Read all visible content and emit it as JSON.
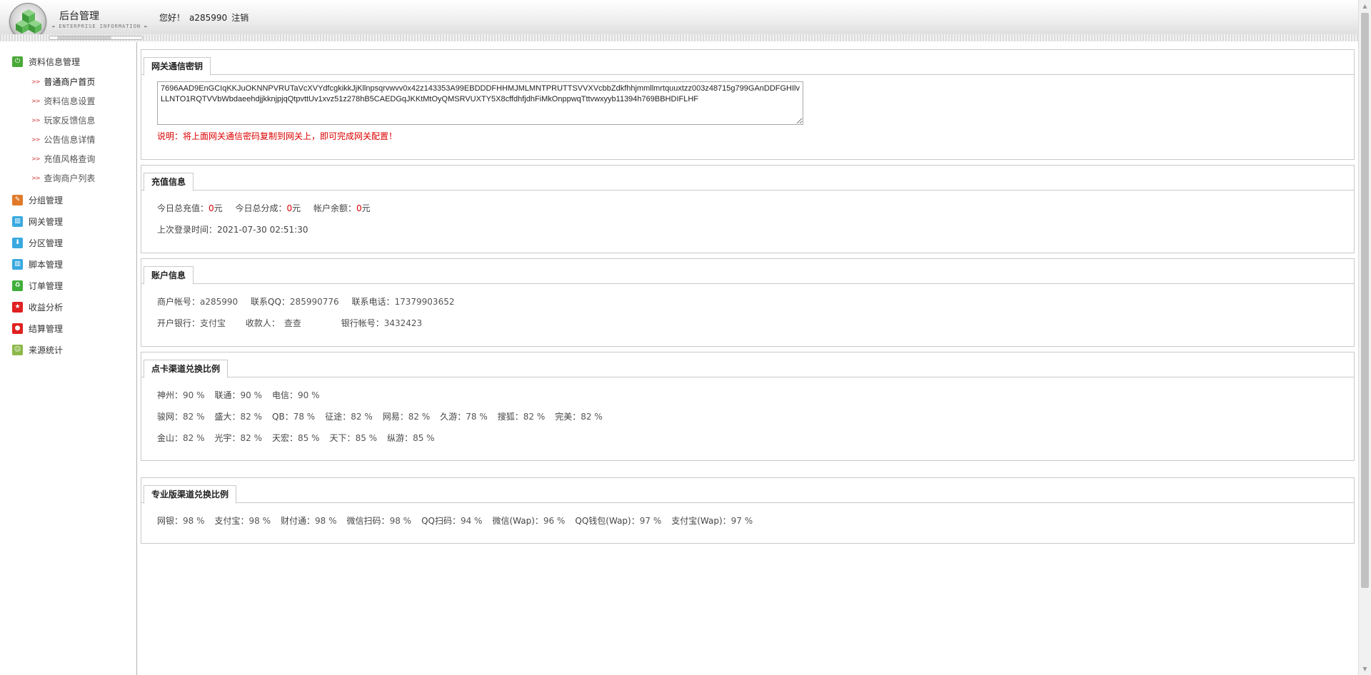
{
  "header": {
    "title": "后台管理",
    "subtitle": "◄ ENTERPRISE INFORMATION ►",
    "greeting": "您好！",
    "username": "a285990",
    "logout": "注销"
  },
  "sidebar": {
    "groups": [
      {
        "label": "资料信息管理",
        "icon": "power-icon",
        "color": "#4aa839",
        "items": [
          "普通商户首页",
          "资料信息设置",
          "玩家反馈信息",
          "公告信息详情",
          "充值风格查询",
          "查询商户列表"
        ]
      },
      {
        "label": "分组管理",
        "icon": "pencil-icon",
        "color": "#e07a2a"
      },
      {
        "label": "网关管理",
        "icon": "gateway-icon",
        "color": "#39a9e0"
      },
      {
        "label": "分区管理",
        "icon": "download-icon",
        "color": "#39a9e0"
      },
      {
        "label": "脚本管理",
        "icon": "script-icon",
        "color": "#39a9e0"
      },
      {
        "label": "订单管理",
        "icon": "recycle-icon",
        "color": "#3fae3a"
      },
      {
        "label": "收益分析",
        "icon": "star-icon",
        "color": "#e02020"
      },
      {
        "label": "结算管理",
        "icon": "play-icon",
        "color": "#e02020"
      },
      {
        "label": "来源统计",
        "icon": "smiley-icon",
        "color": "#8cb84a"
      }
    ]
  },
  "gateway_key": {
    "tab": "网关通信密钥",
    "key": "7696AAD9EnGCIqKKJuOKNNPVRUTaVcXVYdfcgkikkJjKllnpsqrvwvv0x42z143353A99EBDDDFHHMJMLMNTPRUTTSVVXVcbbZdkfhhjmmllmrtquuxtzz003z48715g799GAnDDFGHIlvLLNTO1RQTVVbWbdaeehdjjkknjpjqQtpvttUv1xvz51z278hB5CAEDGqJKKtMtOyQMSRVUXTY5X8cffdhfjdhFiMkOnppwqTttvwxyyb11394h769BBHDIFLHF",
    "note": "说明：将上面网关通信密码复制到网关上，即可完成网关配置！"
  },
  "recharge": {
    "tab": "充值信息",
    "today_total_label": "今日总充值：",
    "today_total_value": "0",
    "today_share_label": "今日总分成：",
    "today_share_value": "0",
    "balance_label": "帐户余额：",
    "balance_value": "0",
    "unit": "元",
    "last_login_label": "上次登录时间：",
    "last_login_value": "2021-07-30 02:51:30"
  },
  "account": {
    "tab": "账户信息",
    "merchant_label": "商户帐号：",
    "merchant_value": "a285990",
    "qq_label": "联系QQ：",
    "qq_value": "285990776",
    "phone_label": "联系电话：",
    "phone_value": "17379903652",
    "bank_label": "开户银行：",
    "bank_value": "支付宝",
    "payee_label": "收款人：",
    "payee_value": "查查",
    "bank_account_label": "银行帐号：",
    "bank_account_value": "3432423"
  },
  "card_rates": {
    "tab": "点卡渠道兑换比例",
    "rows": [
      [
        {
          "name": "神州：",
          "value": "90 %"
        },
        {
          "name": "联通：",
          "value": "90 %"
        },
        {
          "name": "电信：",
          "value": "90 %"
        }
      ],
      [
        {
          "name": "骏网：",
          "value": "82 %"
        },
        {
          "name": "盛大：",
          "value": "82 %"
        },
        {
          "name": "QB：",
          "value": "78 %"
        },
        {
          "name": "征途：",
          "value": "82 %"
        },
        {
          "name": "网易：",
          "value": "82 %"
        },
        {
          "name": "久游：",
          "value": "78 %"
        },
        {
          "name": "搜狐：",
          "value": "82 %"
        },
        {
          "name": "完美：",
          "value": "82 %"
        }
      ],
      [
        {
          "name": "金山：",
          "value": "82 %"
        },
        {
          "name": "光宇：",
          "value": "82 %"
        },
        {
          "name": "天宏：",
          "value": "85 %"
        },
        {
          "name": "天下：",
          "value": "85 %"
        },
        {
          "name": "纵游：",
          "value": "85 %"
        }
      ]
    ]
  },
  "pro_rates": {
    "tab": "专业版渠道兑换比例",
    "items": [
      {
        "name": "网银：",
        "value": "98 %"
      },
      {
        "name": "支付宝：",
        "value": "98 %"
      },
      {
        "name": "财付通：",
        "value": "98 %"
      },
      {
        "name": "微信扫码：",
        "value": "98 %"
      },
      {
        "name": "QQ扫码：",
        "value": "94 %"
      },
      {
        "name": "微信(Wap)：",
        "value": "96 %"
      },
      {
        "name": "QQ钱包(Wap)：",
        "value": "97 %"
      },
      {
        "name": "支付宝(Wap)：",
        "value": "97 %"
      }
    ]
  }
}
